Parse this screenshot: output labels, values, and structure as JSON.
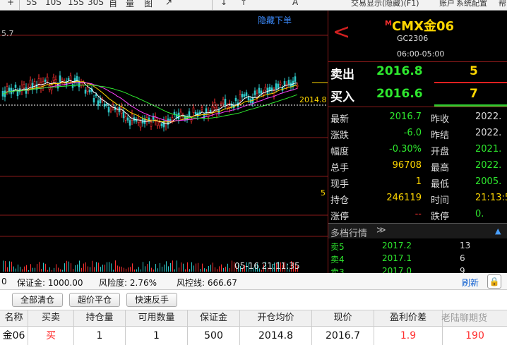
{
  "toolbar": {
    "items": [
      "+",
      "5S",
      "10S",
      "15S",
      "30S",
      "自",
      "量",
      "图",
      "↗",
      "↓",
      "↑",
      "A"
    ],
    "trade_title": "交易显示(隐藏)(F1)",
    "account": "账户",
    "system_config": "系统配置",
    "help": "帮"
  },
  "chart": {
    "hide_order_label": "隐藏下单",
    "top_axis_label": "5.7",
    "cost_line_label": "2014.8",
    "volume_axis_label": "5",
    "timestamp": "05-16 21:11:35",
    "colors": {
      "up": "#ff3030",
      "down": "#2ec8c8",
      "ma1": "#ffffff",
      "ma2": "#ffd700",
      "ma3": "#ff40ff",
      "ma4": "#2ee82e",
      "grid": "#8a1a1a"
    }
  },
  "quote": {
    "prev_label": "<",
    "symbol_prefix": "M",
    "symbol_name": "CMX金06",
    "symbol_code": "GC2306",
    "session": "06:00-05:00",
    "ask": {
      "label": "卖出",
      "price": "2016.8",
      "volume": "5"
    },
    "bid": {
      "label": "买入",
      "price": "2016.6",
      "volume": "7"
    },
    "rows": [
      {
        "l1": "最新",
        "v1": "2016.7",
        "c1": "green",
        "l2": "昨收",
        "v2": "2022.",
        "c2": "white"
      },
      {
        "l1": "涨跌",
        "v1": "-6.0",
        "c1": "green",
        "l2": "昨结",
        "v2": "2022.",
        "c2": "white"
      },
      {
        "l1": "幅度",
        "v1": "-0.30%",
        "c1": "green",
        "l2": "开盘",
        "v2": "2021.",
        "c2": "green"
      },
      {
        "l1": "总手",
        "v1": "96708",
        "c1": "yellow",
        "l2": "最高",
        "v2": "2022.",
        "c2": "green"
      },
      {
        "l1": "现手",
        "v1": "1",
        "c1": "yellow",
        "l2": "最低",
        "v2": "2005.",
        "c2": "green"
      },
      {
        "l1": "持仓",
        "v1": "246119",
        "c1": "yellow",
        "l2": "时间",
        "v2": "21:13:5",
        "c2": "yellow"
      },
      {
        "l1": "涨停",
        "v1": "--",
        "c1": "red",
        "l2": "跌停",
        "v2": "0.",
        "c2": "green"
      }
    ],
    "depth_title": "多档行情",
    "depth_expand_icon": "≫",
    "depth": [
      {
        "label": "卖5",
        "price": "2017.2",
        "vol": "13"
      },
      {
        "label": "卖4",
        "price": "2017.1",
        "vol": "6"
      },
      {
        "label": "卖3",
        "price": "2017.0",
        "vol": "9"
      }
    ]
  },
  "account": {
    "partial_left": "0",
    "margin_label": "保证金: 1000.00",
    "risk_label": "风险度: 2.76%",
    "line_label": "风控线: 666.67",
    "refresh": "刷新",
    "buttons": [
      "全部清仓",
      "超价平仓",
      "快速反手"
    ],
    "columns": [
      "名称",
      "买卖",
      "持仓量",
      "可用数量",
      "保证金",
      "开仓均价",
      "现价",
      "盈利价差",
      ""
    ],
    "row": [
      "金06",
      "买",
      "1",
      "1",
      "500",
      "2014.8",
      "2016.7",
      "1.9",
      "190"
    ]
  },
  "watermark": "老陆聊期货"
}
